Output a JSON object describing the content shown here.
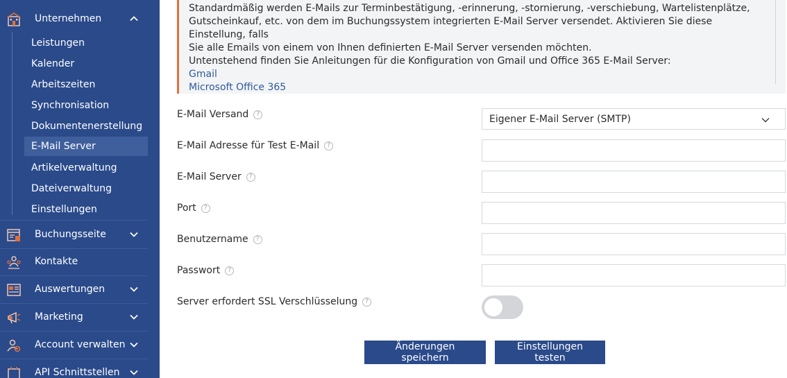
{
  "sidebar": {
    "sections_top": [
      {
        "label": "Unternehmen",
        "icon": "building-icon",
        "expanded": true
      }
    ],
    "sub_items": [
      {
        "label": "Leistungen",
        "active": false
      },
      {
        "label": "Kalender",
        "active": false
      },
      {
        "label": "Arbeitszeiten",
        "active": false
      },
      {
        "label": "Synchronisation",
        "active": false
      },
      {
        "label": "Dokumentenerstellung",
        "active": false
      },
      {
        "label": "E-Mail Server",
        "active": true
      },
      {
        "label": "Artikelverwaltung",
        "active": false
      },
      {
        "label": "Dateiverwaltung",
        "active": false
      },
      {
        "label": "Einstellungen",
        "active": false
      }
    ],
    "sections": [
      {
        "label": "Buchungsseite",
        "icon": "booking-page-icon",
        "has_chevron": true
      },
      {
        "label": "Kontakte",
        "icon": "contacts-icon",
        "has_chevron": false
      },
      {
        "label": "Auswertungen",
        "icon": "reports-icon",
        "has_chevron": true
      },
      {
        "label": "Marketing",
        "icon": "marketing-icon",
        "has_chevron": true
      },
      {
        "label": "Account verwalten",
        "icon": "account-gear-icon",
        "has_chevron": true
      },
      {
        "label": "API Schnittstellen",
        "icon": "api-icon",
        "has_chevron": true
      }
    ]
  },
  "info": {
    "line1": "Standardmäßig werden E-Mails zur Terminbestätigung, -erinnerung, -stornierung, -verschiebung, Wartelistenplätze,",
    "line2": "Gutscheinkauf, etc. von dem im Buchungssystem integrierten E-Mail Server versendet. Aktivieren Sie diese Einstellung, falls",
    "line3": "Sie alle Emails von einem von Ihnen definierten E-Mail Server versenden möchten.",
    "line4": "Untenstehend finden Sie Anleitungen für die Konfiguration von Gmail und Office 365 E-Mail Server:",
    "link_gmail": "Gmail",
    "link_office": "Microsoft Office 365"
  },
  "form": {
    "email_versand_label": "E-Mail Versand",
    "email_versand_value": "Eigener E-Mail Server (SMTP)",
    "test_email_label": "E-Mail Adresse für Test E-Mail",
    "test_email_value": "",
    "server_label": "E-Mail Server",
    "server_value": "",
    "port_label": "Port",
    "port_value": "",
    "username_label": "Benutzername",
    "username_value": "",
    "password_label": "Passwort",
    "password_value": "",
    "ssl_label": "Server erfordert SSL Verschlüsselung",
    "ssl_enabled": false,
    "help_glyph": "?"
  },
  "buttons": {
    "save": "Änderungen speichern",
    "test": "Einstellungen testen"
  },
  "colors": {
    "sidebar_bg": "#2a4a8a",
    "accent_orange": "#e0703a",
    "link_blue": "#2f5a9c",
    "button_bg": "#2a4a8a"
  }
}
